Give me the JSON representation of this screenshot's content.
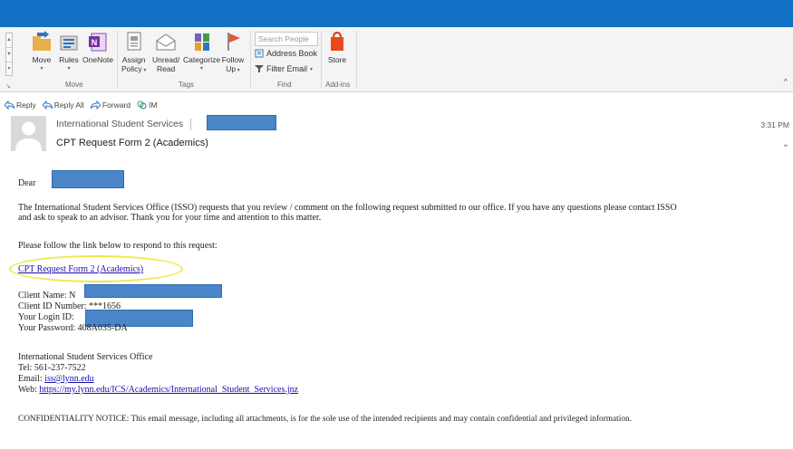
{
  "ribbon": {
    "buttons": {
      "move": "Move",
      "rules": "Rules",
      "onenote": "OneNote",
      "assign_policy_1": "Assign",
      "assign_policy_2": "Policy",
      "unread_read_1": "Unread/",
      "unread_read_2": "Read",
      "categorize": "Categorize",
      "follow_up_1": "Follow",
      "follow_up_2": "Up",
      "store": "Store"
    },
    "groups": {
      "move": "Move",
      "tags": "Tags",
      "find": "Find",
      "addins": "Add-ins"
    },
    "search_people_placeholder": "Search People",
    "address_book": "Address Book",
    "filter_email": "Filter Email"
  },
  "actions": {
    "reply": "Reply",
    "reply_all": "Reply All",
    "forward": "Forward",
    "im": "IM"
  },
  "header": {
    "sender": "International Student Services",
    "subject": "CPT Request Form 2 (Academics)",
    "time": "3:31 PM"
  },
  "body": {
    "greeting": "Dear",
    "intro_line1": "The International Student Services Office (ISSO) requests that you review / comment on the following request submitted to our office.  If you have any questions please contact ISSO",
    "intro_line2": "and ask to speak to an advisor.  Thank you for your time and attention to this matter.",
    "follow_link": "Please follow the link below to respond to this request:",
    "link_text": "CPT Request Form 2 (Academics)",
    "client_name_label": "Client Name: N",
    "client_id_label": "Client ID Number: ***1656",
    "login_id_label": "Your Login ID:",
    "password_label": "Your Password: 408A035-DA",
    "office_name": "International Student Services Office",
    "tel": "Tel:  561-237-7522",
    "email_label": "Email:",
    "email_value": "iss@lynn.edu",
    "web_label": "Web:",
    "web_value": "https://my.lynn.edu/ICS/Academics/International_Student_Services.jnz",
    "confidentiality": "CONFIDENTIALITY NOTICE: This email message, including all attachments, is for the sole use of the intended recipients and may contain confidential and privileged information."
  },
  "colors": {
    "titlebar": "#1170c4",
    "redaction": "#4a86c8",
    "highlight": "#f0e84a",
    "link": "#1a0dab"
  }
}
